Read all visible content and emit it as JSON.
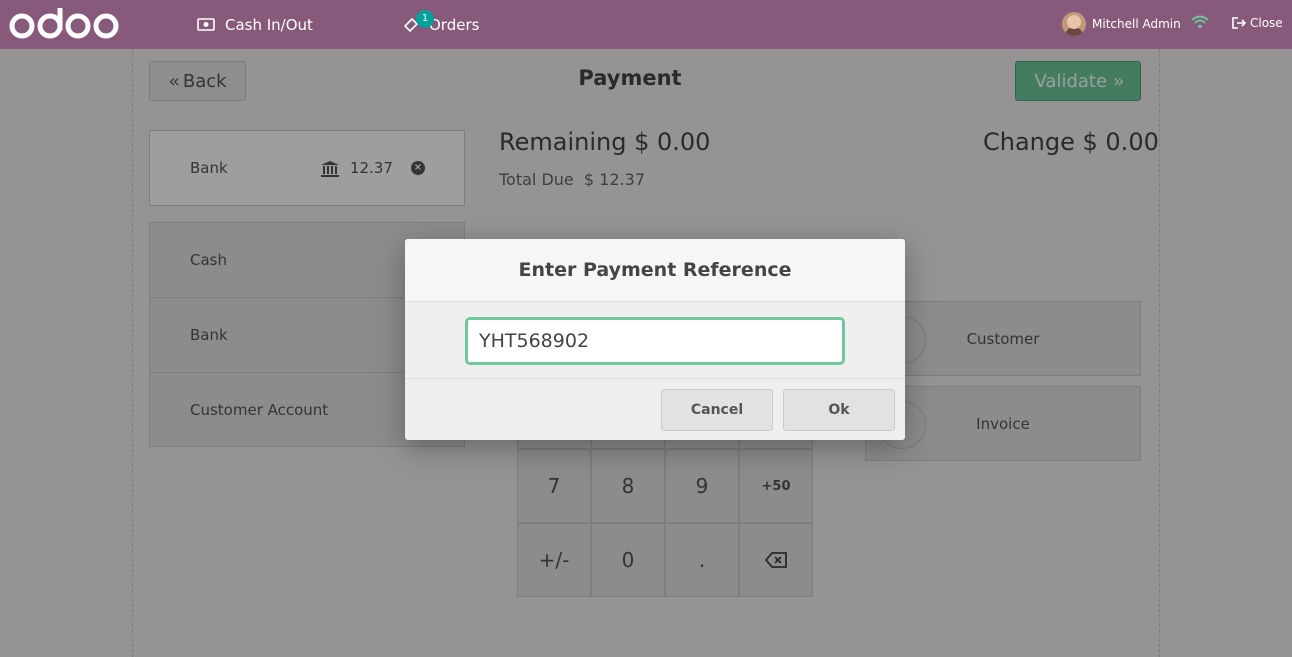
{
  "topbar": {
    "logo": "odoo",
    "cash_label": "Cash In/Out",
    "orders_label": "Orders",
    "orders_count": "1",
    "user_name": "Mitchell Admin",
    "close_label": "Close"
  },
  "header": {
    "back_label": "Back",
    "title": "Payment",
    "validate_label": "Validate"
  },
  "payment_line": {
    "method": "Bank",
    "amount": "12.37"
  },
  "methods": [
    "Cash",
    "Bank",
    "Customer Account"
  ],
  "summary": {
    "remaining": "Remaining $ 0.00",
    "change": "Change $ 0.00",
    "total_due": "Total Due  $ 12.37"
  },
  "side_buttons": {
    "customer": "Customer",
    "invoice": "Invoice"
  },
  "numpad": {
    "row3": [
      "7",
      "8",
      "9",
      "+50"
    ],
    "row4": [
      "+/-",
      "0",
      "."
    ]
  },
  "modal": {
    "title": "Enter Payment Reference",
    "input_value": "YHT568902",
    "cancel_label": "Cancel",
    "ok_label": "Ok"
  },
  "colors": {
    "topbar": "#875a7b",
    "validate": "#6ec89b",
    "accent_badge": "#00a09d"
  }
}
